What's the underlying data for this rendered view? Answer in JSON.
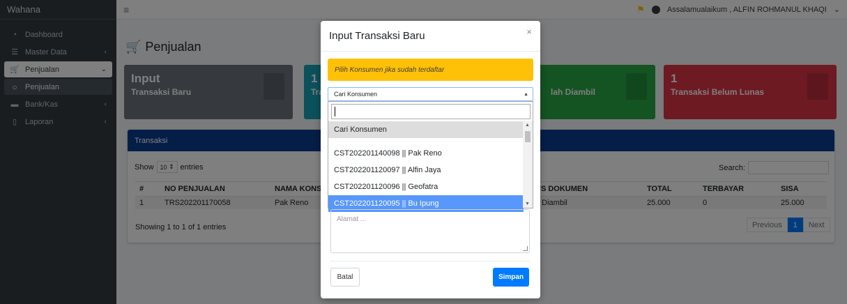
{
  "sidebar": {
    "brand": "Wahana",
    "items": [
      {
        "icon": "dashboard-icon",
        "label": "Dashboard",
        "chevron": ""
      },
      {
        "icon": "database-icon",
        "label": "Master Data",
        "chevron": "‹"
      },
      {
        "icon": "cart-icon",
        "label": "Penjualan",
        "chevron": "⌄"
      },
      {
        "icon": "circle-icon",
        "label": "Penjualan",
        "chevron": ""
      },
      {
        "icon": "bank-icon",
        "label": "Bank/Kas",
        "chevron": "‹"
      },
      {
        "icon": "file-icon",
        "label": "Laporan",
        "chevron": "‹"
      }
    ]
  },
  "topbar": {
    "greeting": "Assalamualaikum , ALFIN ROHMANUL KHAQI",
    "user_chevron": "⌄"
  },
  "page": {
    "title": "Penjualan"
  },
  "boxes": [
    {
      "num": "Input",
      "label": "Transaksi Baru",
      "color": "#6c757d"
    },
    {
      "num": "1",
      "label": "Tra",
      "color": "#17a2b8"
    },
    {
      "num": "",
      "label": "lah Diambil",
      "color": "#28a745"
    },
    {
      "num": "1",
      "label": "Transaksi Belum Lunas",
      "color": "#dc3545"
    }
  ],
  "card": {
    "title": "Transaksi",
    "show_label": "Show",
    "entries_value": "10",
    "entries_label": "entries",
    "search_label": "Search:",
    "columns": [
      "#",
      "NO PENJUALAN",
      "NAMA KONSU",
      "US DOKUMEN",
      "TOTAL",
      "TERBAYAR",
      "SISA"
    ],
    "rows": [
      [
        "1",
        "TRS202201170058",
        "Pak Reno",
        "n Diambil",
        "25.000",
        "0",
        "25.000"
      ]
    ],
    "info": "Showing 1 to 1 of 1 entries",
    "pager": {
      "prev": "Previous",
      "current": "1",
      "next": "Next"
    }
  },
  "modal": {
    "title": "Input Transaksi Baru",
    "close": "×",
    "alert": "Pilih Konsumen jika sudah terdaftar",
    "combo_value": "Cari Konsumen",
    "options": [
      "Cari Konsumen",
      "CST202201140098 || Pak Reno",
      "CST202201120097 || Alfin Jaya",
      "CST202201120096 || Geofatra",
      "CST202201120095 || Bu Ipung"
    ],
    "address_placeholder": "Alamat ...",
    "cancel_label": "Batal",
    "save_label": "Simpan"
  }
}
